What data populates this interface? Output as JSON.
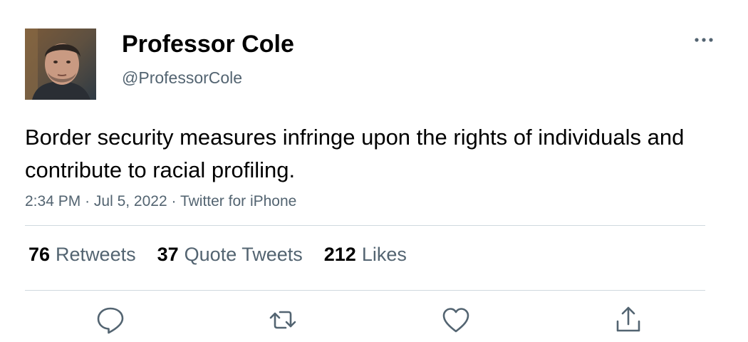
{
  "author": {
    "display_name": "Professor Cole",
    "handle": "@ProfessorCole",
    "avatar_icon": "user-avatar-photo"
  },
  "tweet": {
    "text": "Border security measures infringe upon the rights of individuals and contribute to racial profiling.",
    "time": "2:34 PM",
    "separator": "·",
    "date": "Jul 5, 2022",
    "source": "Twitter for iPhone"
  },
  "stats": {
    "retweets_count": "76",
    "retweets_label": "Retweets",
    "quotes_count": "37",
    "quotes_label": "Quote Tweets",
    "likes_count": "212",
    "likes_label": "Likes"
  },
  "actions": {
    "icons": [
      "reply-icon",
      "retweet-icon",
      "like-icon",
      "share-icon"
    ],
    "more_icon": "more-horizontal-icon"
  },
  "colors": {
    "primary_text": "#0f1419",
    "secondary_text": "#536471",
    "divider": "#cfd9de"
  }
}
